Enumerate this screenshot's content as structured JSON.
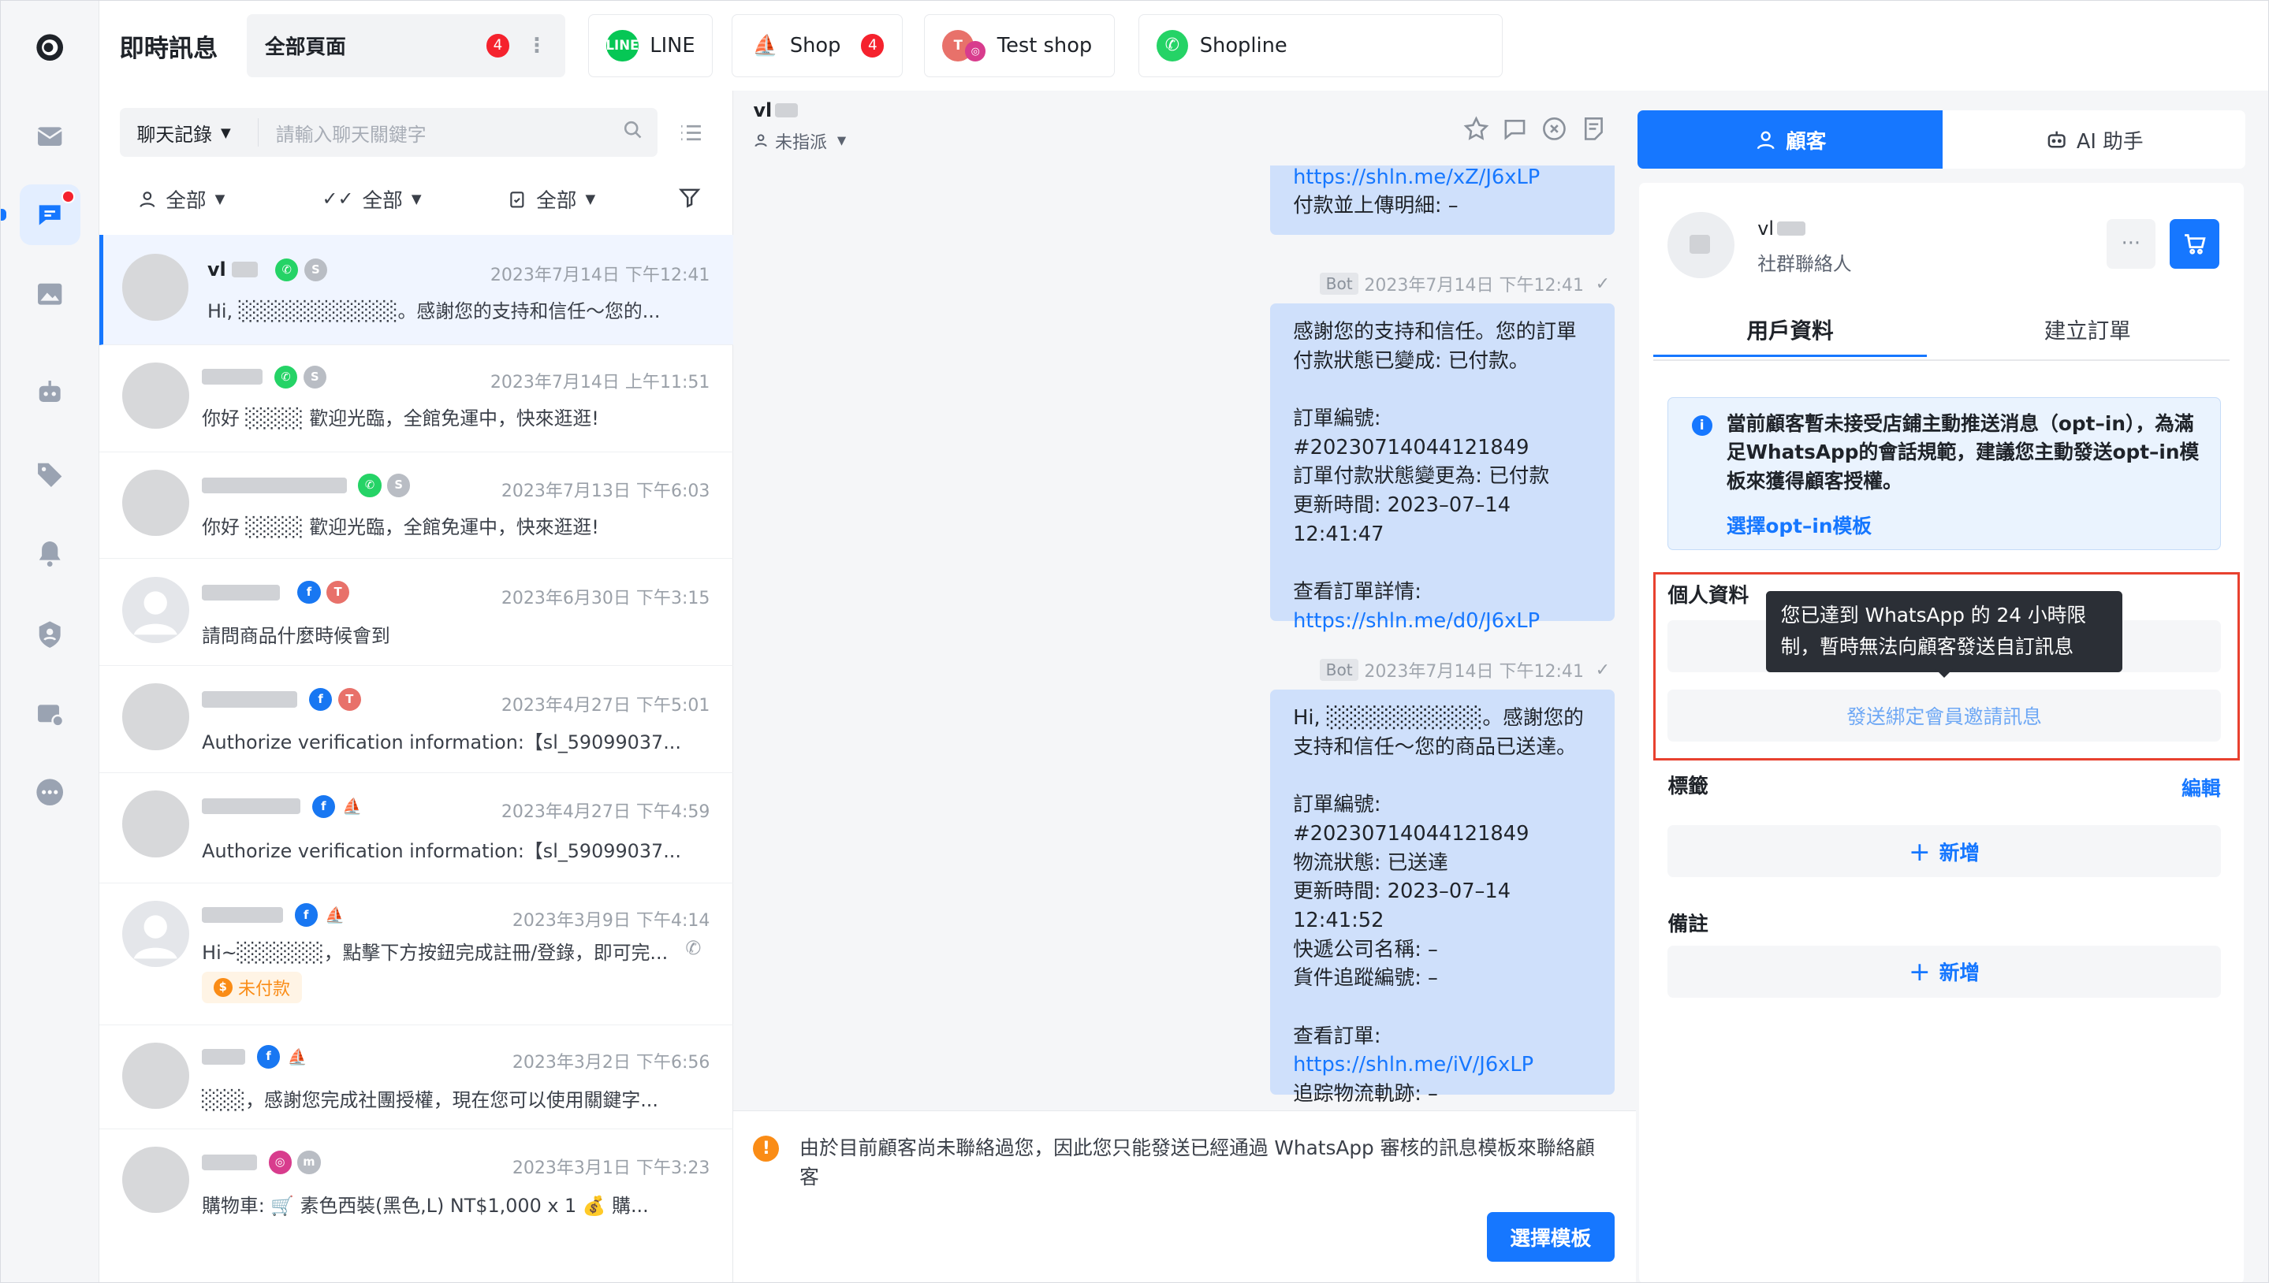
{
  "app": {
    "title": "即時訊息"
  },
  "page_tabs": [
    {
      "label": "全部頁面",
      "badge": "4"
    },
    {
      "label": "LINE",
      "badge": ""
    },
    {
      "label": "Shop",
      "badge": "4"
    },
    {
      "label": "Test shop",
      "badge": ""
    },
    {
      "label": "Shopline",
      "badge": ""
    }
  ],
  "search": {
    "scope": "聊天記錄",
    "placeholder": "請輸入聊天關鍵字"
  },
  "filters": {
    "assignee": "全部",
    "read": "全部",
    "status": "全部"
  },
  "chats": [
    {
      "name": "vl",
      "time": "2023年7月14日 下午12:41",
      "message": "Hi, ░░░░░░░░░░░。感謝您的支持和信任～您的...",
      "channels": [
        "whatsapp",
        "shopline"
      ]
    },
    {
      "name": "",
      "time": "2023年7月14日 上午11:51",
      "message": "你好 ░░░░ 歡迎光臨，全館免運中，快來逛逛!",
      "channels": [
        "whatsapp",
        "shopline"
      ]
    },
    {
      "name": "",
      "time": "2023年7月13日 下午6:03",
      "message": "你好 ░░░░ 歡迎光臨，全館免運中，快來逛逛!",
      "channels": [
        "whatsapp",
        "shopline"
      ]
    },
    {
      "name": "",
      "time": "2023年6月30日 下午3:15",
      "message": "請問商品什麼時候會到",
      "channels": [
        "facebook",
        "test"
      ]
    },
    {
      "name": "",
      "time": "2023年4月27日 下午5:01",
      "message": "Authorize verification information:【sl_59099037...",
      "channels": [
        "facebook",
        "test"
      ]
    },
    {
      "name": "",
      "time": "2023年4月27日 下午4:59",
      "message": "Authorize verification information:【sl_59099037...",
      "channels": [
        "facebook",
        "shop"
      ]
    },
    {
      "name": "",
      "time": "2023年3月9日 下午4:14",
      "message": "Hi~░░░░░░，點擊下方按鈕完成註冊/登錄，即可完...",
      "channels": [
        "facebook",
        "shop"
      ],
      "tag": "未付款"
    },
    {
      "name": "",
      "time": "2023年3月2日 下午6:56",
      "message": "░░░，感謝您完成社團授權，現在您可以使用關鍵字...",
      "channels": [
        "facebook",
        "shop"
      ]
    },
    {
      "name": "",
      "time": "2023年3月1日 下午3:23",
      "message": "購物車: 🛒 素色西裝(黑色,L) NT$1,000 x 1   💰 購...",
      "channels": [
        "instagram",
        "m"
      ]
    }
  ],
  "conversation": {
    "contact_name": "vl",
    "assign_status": "未指派",
    "messages": [
      {
        "lines": [
          "https://shln.me/xZ/J6xLP",
          "付款並上傳明細: –"
        ]
      },
      {
        "sender": "Bot",
        "time": "2023年7月14日 下午12:41",
        "lines": [
          "感謝您的支持和信任。您的訂單付款狀態已變成: 已付款。",
          "",
          "訂單編號: ",
          "#20230714044121849",
          "訂單付款狀態變更為: 已付款",
          "更新時間: 2023–07–14 12:41:47",
          "",
          "查看訂單詳情:",
          "https://shln.me/d0/J6xLP"
        ]
      },
      {
        "sender": "Bot",
        "time": "2023年7月14日 下午12:41",
        "lines": [
          "Hi, ░░░░░░░░░░。感謝您的支持和信任～您的商品已送達。",
          "",
          "訂單編號: ",
          "#20230714044121849",
          "物流狀態: 已送達",
          "更新時間: 2023–07–14 12:41:52",
          "快遞公司名稱: –",
          "貨件追蹤編號: –",
          "",
          "查看訂單:",
          "https://shln.me/iV/J6xLP",
          "追踪物流軌跡: –"
        ]
      }
    ],
    "warning": "由於目前顧客尚未聯絡過您，因此您只能發送已經通過 WhatsApp 審核的訊息模板來聯絡顧客",
    "template_button": "選擇模板"
  },
  "panel": {
    "tabs": [
      {
        "label": "顧客"
      },
      {
        "label": "AI 助手"
      }
    ],
    "customer_name": "vl",
    "customer_type": "社群聯絡人",
    "sub_tabs": [
      {
        "label": "用戶資料"
      },
      {
        "label": "建立訂單"
      }
    ],
    "notice": "當前顧客暫未接受店鋪主動推送消息（opt–in），為滿足WhatsApp的會話規範，建議您主動發送opt–in模板來獲得顧客授權。",
    "notice_link": "選擇opt–in模板",
    "personal_title": "個人資料",
    "send_invite": "發送綁定會員邀請訊息",
    "tags_title": "標籤",
    "edit_label": "編輯",
    "add_label": "新增",
    "notes_title": "備註",
    "tooltip": "您已達到 WhatsApp 的 24 小時限制，暫時無法向顧客發送自訂訊息"
  },
  "colors": {
    "accent": "#1677ff",
    "badge": "#f5222d",
    "bubble": "#cfe0fb",
    "highlight_box": "#e8412f",
    "whatsapp": "#25d366",
    "line": "#06c755",
    "facebook": "#1877f2"
  }
}
